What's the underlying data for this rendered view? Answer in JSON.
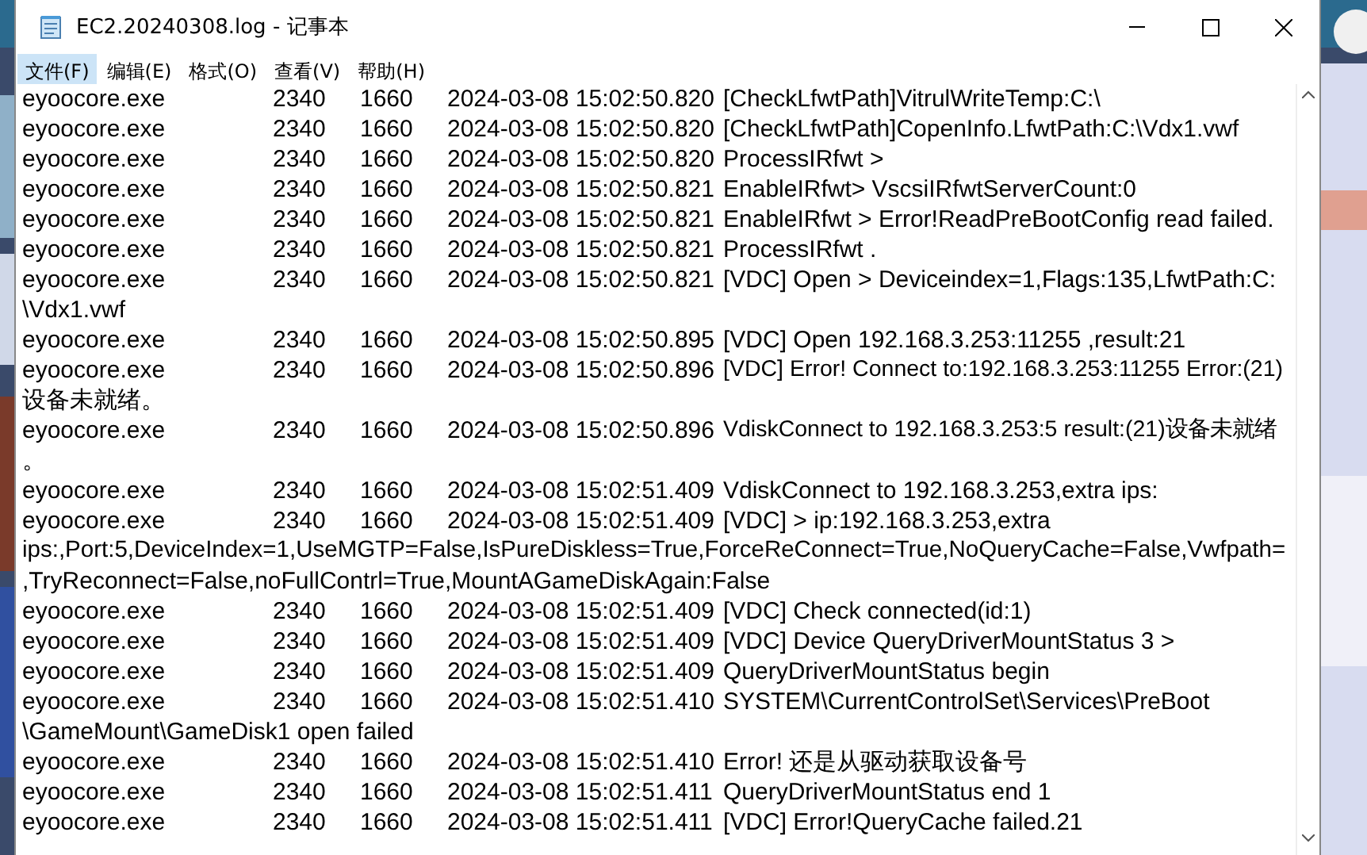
{
  "window": {
    "title": "EC2.20240308.log - 记事本"
  },
  "menu": [
    {
      "label": "文件(F)",
      "selected": true
    },
    {
      "label": "编辑(E)",
      "selected": false
    },
    {
      "label": "格式(O)",
      "selected": false
    },
    {
      "label": "查看(V)",
      "selected": false
    },
    {
      "label": "帮助(H)",
      "selected": false
    }
  ],
  "lines": [
    {
      "kind": "entry",
      "process": "eyoocore.exe",
      "pid": "2340",
      "tid": "1660",
      "time": "2024-03-08 15:02:50.820",
      "message": "[CheckLfwtPath]VitrulWriteTemp:C:\\"
    },
    {
      "kind": "entry",
      "process": "eyoocore.exe",
      "pid": "2340",
      "tid": "1660",
      "time": "2024-03-08 15:02:50.820",
      "message": "[CheckLfwtPath]CopenInfo.LfwtPath:C:\\Vdx1.vwf"
    },
    {
      "kind": "entry",
      "process": "eyoocore.exe",
      "pid": "2340",
      "tid": "1660",
      "time": "2024-03-08 15:02:50.820",
      "message": "ProcessIRfwt >"
    },
    {
      "kind": "entry",
      "process": "eyoocore.exe",
      "pid": "2340",
      "tid": "1660",
      "time": "2024-03-08 15:02:50.821",
      "message": "EnableIRfwt> VscsiIRfwtServerCount:0"
    },
    {
      "kind": "entry",
      "process": "eyoocore.exe",
      "pid": "2340",
      "tid": "1660",
      "time": "2024-03-08 15:02:50.821",
      "message": "EnableIRfwt > Error!ReadPreBootConfig read failed."
    },
    {
      "kind": "entry",
      "process": "eyoocore.exe",
      "pid": "2340",
      "tid": "1660",
      "time": "2024-03-08 15:02:50.821",
      "message": "ProcessIRfwt ."
    },
    {
      "kind": "entry",
      "process": "eyoocore.exe",
      "pid": "2340",
      "tid": "1660",
      "time": "2024-03-08 15:02:50.821",
      "message": "[VDC] Open > Deviceindex=1,Flags:135,LfwtPath:C:"
    },
    {
      "kind": "wrap",
      "text": "\\Vdx1.vwf"
    },
    {
      "kind": "entry",
      "process": "eyoocore.exe",
      "pid": "2340",
      "tid": "1660",
      "time": "2024-03-08 15:02:50.895",
      "message": "[VDC] Open 192.168.3.253:11255 ,result:21"
    },
    {
      "kind": "entry",
      "process": "eyoocore.exe",
      "pid": "2340",
      "tid": "1660",
      "time": "2024-03-08 15:02:50.896",
      "message": "[VDC] Error! Connect to:192.168.3.253:11255 Error:(21)"
    },
    {
      "kind": "wrap",
      "text": "设备未就绪。"
    },
    {
      "kind": "entry",
      "process": "eyoocore.exe",
      "pid": "2340",
      "tid": "1660",
      "time": "2024-03-08 15:02:50.896",
      "message": "VdiskConnect to 192.168.3.253:5 result:(21)设备未就绪"
    },
    {
      "kind": "wrap",
      "text": "。"
    },
    {
      "kind": "entry",
      "process": "eyoocore.exe",
      "pid": "2340",
      "tid": "1660",
      "time": "2024-03-08 15:02:51.409",
      "message": "VdiskConnect to 192.168.3.253,extra ips:"
    },
    {
      "kind": "entry",
      "process": "eyoocore.exe",
      "pid": "2340",
      "tid": "1660",
      "time": "2024-03-08 15:02:51.409",
      "message": "[VDC] > ip:192.168.3.253,extra"
    },
    {
      "kind": "wrap",
      "text": "ips:,Port:5,DeviceIndex=1,UseMGTP=False,IsPureDiskless=True,ForceReConnect=True,NoQueryCache=False,Vwfpath="
    },
    {
      "kind": "wrap",
      "text": ",TryReconnect=False,noFullContrl=True,MountAGameDiskAgain:False"
    },
    {
      "kind": "entry",
      "process": "eyoocore.exe",
      "pid": "2340",
      "tid": "1660",
      "time": "2024-03-08 15:02:51.409",
      "message": "[VDC] Check connected(id:1)"
    },
    {
      "kind": "entry",
      "process": "eyoocore.exe",
      "pid": "2340",
      "tid": "1660",
      "time": "2024-03-08 15:02:51.409",
      "message": "[VDC] Device QueryDriverMountStatus 3 >"
    },
    {
      "kind": "entry",
      "process": "eyoocore.exe",
      "pid": "2340",
      "tid": "1660",
      "time": "2024-03-08 15:02:51.409",
      "message": "QueryDriverMountStatus begin"
    },
    {
      "kind": "entry",
      "process": "eyoocore.exe",
      "pid": "2340",
      "tid": "1660",
      "time": "2024-03-08 15:02:51.410",
      "message": "SYSTEM\\CurrentControlSet\\Services\\PreBoot"
    },
    {
      "kind": "wrap",
      "text": "\\GameMount\\GameDisk1 open failed"
    },
    {
      "kind": "entry",
      "process": "eyoocore.exe",
      "pid": "2340",
      "tid": "1660",
      "time": "2024-03-08 15:02:51.410",
      "message": "Error! 还是从驱动获取设备号"
    },
    {
      "kind": "entry",
      "process": "eyoocore.exe",
      "pid": "2340",
      "tid": "1660",
      "time": "2024-03-08 15:02:51.411",
      "message": "QueryDriverMountStatus end 1"
    },
    {
      "kind": "entry",
      "process": "eyoocore.exe",
      "pid": "2340",
      "tid": "1660",
      "time": "2024-03-08 15:02:51.411",
      "message": "[VDC] Error!QueryCache failed.21"
    }
  ]
}
